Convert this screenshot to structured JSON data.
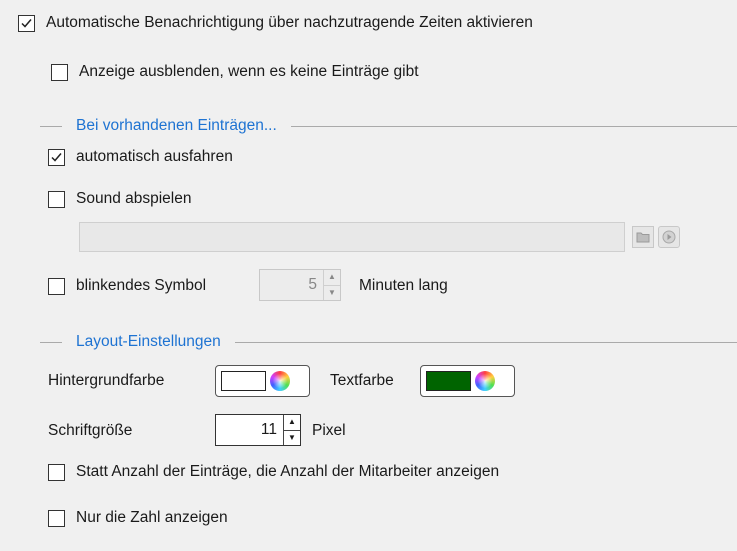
{
  "notification": {
    "enable_label": "Automatische Benachrichtigung über nachzutragende Zeiten aktivieren",
    "enable_checked": true,
    "hide_label": "Anzeige ausblenden, wenn es keine Einträge gibt",
    "hide_checked": false
  },
  "entries_section": {
    "title": "Bei vorhandenen Einträgen...",
    "auto_expand_label": "automatisch ausfahren",
    "auto_expand_checked": true,
    "sound_label": "Sound abspielen",
    "sound_checked": false,
    "sound_path": "",
    "blink_label": "blinkendes Symbol",
    "blink_checked": false,
    "blink_minutes": "5",
    "blink_suffix": "Minuten lang"
  },
  "layout_section": {
    "title": "Layout-Einstellungen",
    "background_label": "Hintergrundfarbe",
    "background_color": "#ffffff",
    "text_label": "Textfarbe",
    "text_color": "#006400",
    "font_size_label": "Schriftgröße",
    "font_size_value": "11",
    "font_size_unit": "Pixel",
    "employees_label": "Statt Anzahl der Einträge, die Anzahl der Mitarbeiter anzeigen",
    "employees_checked": false,
    "number_only_label": "Nur die Zahl anzeigen",
    "number_only_checked": false
  },
  "colors": {
    "accent": "#1e73d2",
    "separator": "#aaaaaa"
  }
}
